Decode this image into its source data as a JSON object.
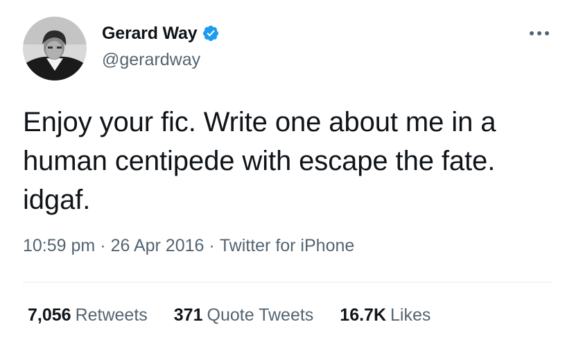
{
  "author": {
    "display_name": "Gerard Way",
    "handle": "@gerardway",
    "verified": true,
    "verified_color": "#1d9bf0",
    "avatar_icon": "profile-photo"
  },
  "tweet": {
    "text": "Enjoy your fic. Write one about me in a human centipede with escape the fate. idgaf.",
    "time": "10:59 pm",
    "date": "26 Apr 2016",
    "separator": "·",
    "source": "Twitter for iPhone"
  },
  "stats": {
    "retweets_count": "7,056",
    "retweets_label": "Retweets",
    "quotes_count": "371",
    "quotes_label": "Quote Tweets",
    "likes_count": "16.7K",
    "likes_label": "Likes"
  },
  "more_icon": "more-horizontal-icon"
}
